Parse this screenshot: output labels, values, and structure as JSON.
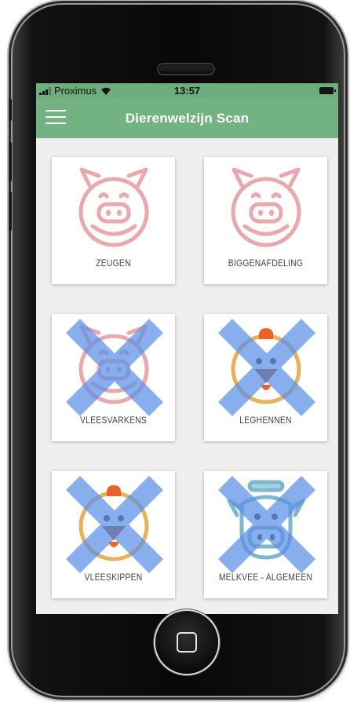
{
  "status_bar": {
    "carrier": "Proximus",
    "time": "13:57"
  },
  "header": {
    "title": "Dierenwelzijn Scan",
    "menu_icon": "hamburger-menu-icon"
  },
  "colors": {
    "status_bar": "#6eae7c",
    "nav_bar": "#73b381",
    "background": "#efefef",
    "pig_pink": "#e8a8ae",
    "chicken_comb": "#e8622a",
    "chicken_ring": "#e6b25c",
    "cow_blue": "#7eb6cc",
    "disabled_cross": "#5c8fe6"
  },
  "cards": [
    {
      "label": "ZEUGEN",
      "icon": "pig-icon",
      "disabled": false
    },
    {
      "label": "BIGGENAFDELING",
      "icon": "pig-icon",
      "disabled": false
    },
    {
      "label": "VLEESVARKENS",
      "icon": "pig-icon",
      "disabled": true
    },
    {
      "label": "LEGHENNEN",
      "icon": "chicken-icon",
      "disabled": true
    },
    {
      "label": "VLEESKIPPEN",
      "icon": "chicken-icon",
      "disabled": true
    },
    {
      "label": "MELKVEE - ALGEMEEN",
      "icon": "cow-icon",
      "disabled": true
    }
  ]
}
